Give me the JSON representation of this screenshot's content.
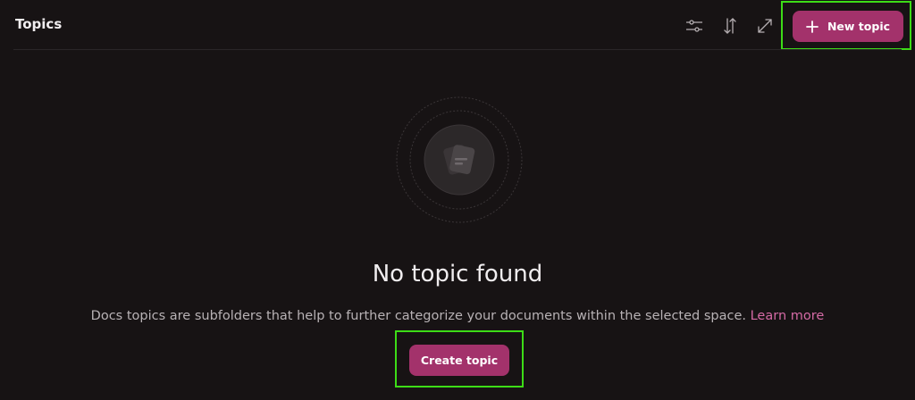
{
  "header": {
    "title": "Topics",
    "icons": [
      "filter-sliders-icon",
      "sort-arrows-icon",
      "expand-icon"
    ],
    "new_topic_label": "New topic"
  },
  "empty_state": {
    "icon": "documents-icon",
    "title": "No topic found",
    "description": "Docs topics are subfolders that help to further categorize your documents within the selected space.",
    "learn_more": "Learn more",
    "create_label": "Create topic"
  },
  "colors": {
    "background": "#171314",
    "accent": "#a3326b",
    "link": "#d56aa5",
    "highlight": "#3ddc17"
  }
}
